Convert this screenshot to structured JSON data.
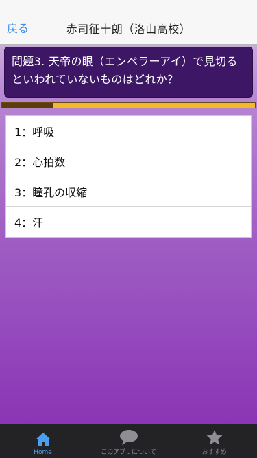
{
  "nav": {
    "back_label": "戻る",
    "title": "赤司征十朗（洛山高校）"
  },
  "question": {
    "text": "問題3. 天帝の眼（エンペラーアイ）で見切るといわれていないものはどれか？"
  },
  "progress": {
    "value": 0.2
  },
  "answers": [
    {
      "label": "1：呼吸"
    },
    {
      "label": "2：心拍数"
    },
    {
      "label": "3：瞳孔の収縮"
    },
    {
      "label": "4：汗"
    }
  ],
  "tabbar": {
    "items": [
      {
        "label": "Home",
        "icon": "home-icon",
        "active": true
      },
      {
        "label": "このアプリについて",
        "icon": "speech-bubble-icon",
        "active": false
      },
      {
        "label": "おすすめ",
        "icon": "star-icon",
        "active": false
      }
    ]
  },
  "colors": {
    "accent": "#4aa0f0",
    "question_bg": "#3d1766",
    "progress_bar": "#f2b92d",
    "progress_fill": "#5b3d0a",
    "tabbar_bg": "#232326"
  }
}
